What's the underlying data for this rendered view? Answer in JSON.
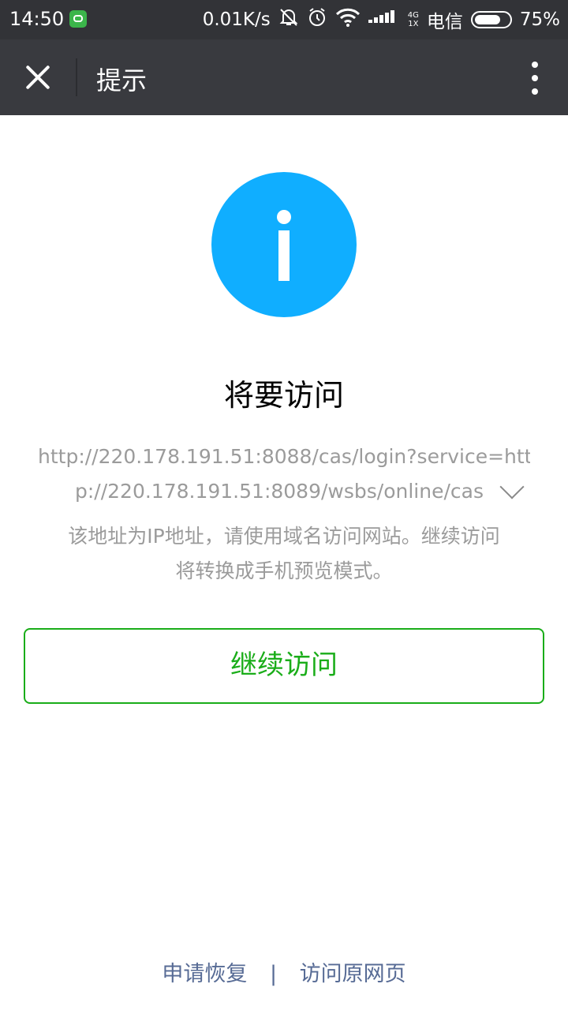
{
  "status_bar": {
    "time": "14:50",
    "network_speed": "0.01K/s",
    "signal_top": "4G",
    "signal_bottom": "1X",
    "carrier": "电信",
    "battery_percent": "75%"
  },
  "title_bar": {
    "title": "提示"
  },
  "content": {
    "headline": "将要访问",
    "url_line1": "http://220.178.191.51:8088/cas/login?service=htt",
    "url_line2": "p://220.178.191.51:8089/wsbs/online/cas",
    "note_line1": "该地址为IP地址，请使用域名访问网站。继续访问",
    "note_line2": "将转换成手机预览模式。",
    "continue_button": "继续访问"
  },
  "footer": {
    "appeal_link": "申请恢复",
    "separator": "|",
    "original_link": "访问原网页"
  },
  "colors": {
    "accent_green": "#1aad19",
    "info_blue": "#10aeff",
    "link_blue": "#576b95"
  }
}
